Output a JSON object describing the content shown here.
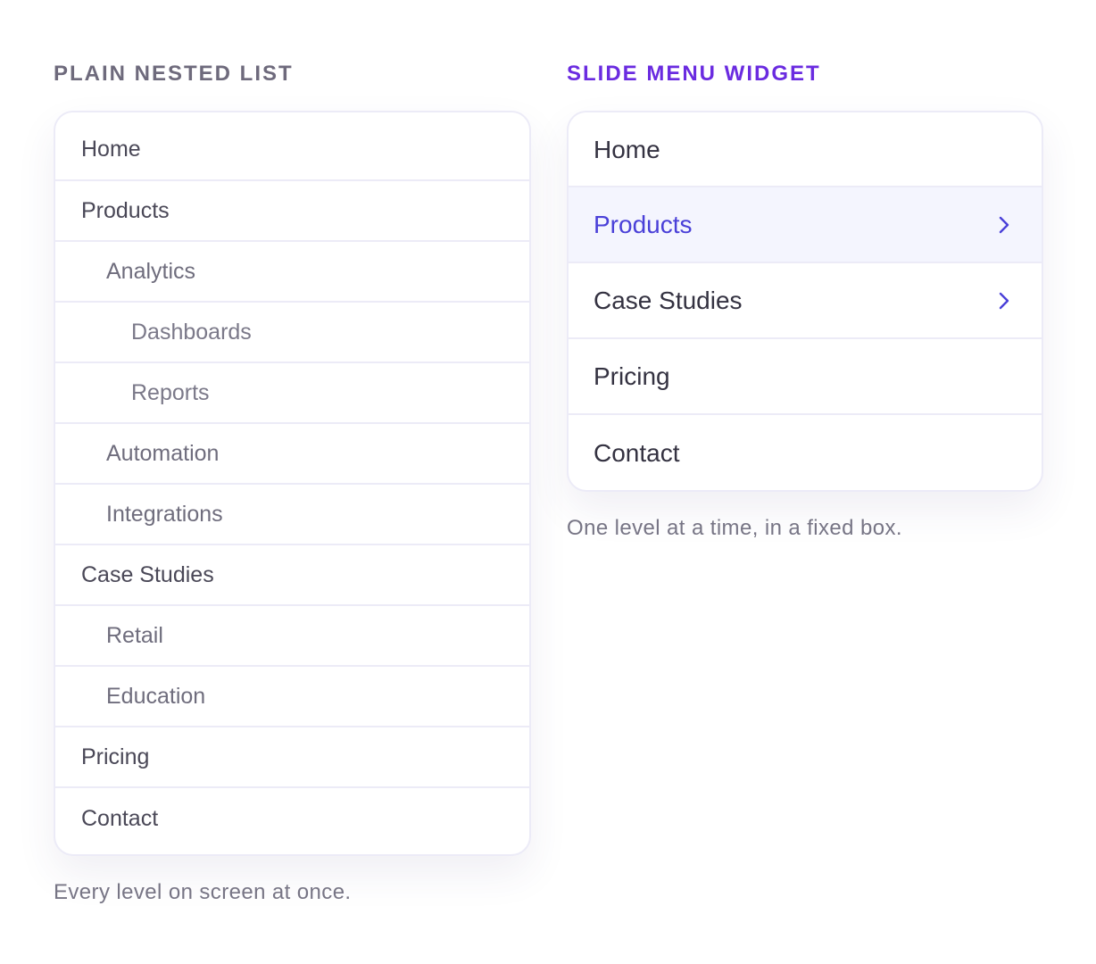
{
  "plain_panel": {
    "heading": "PLAIN NESTED LIST",
    "items": [
      {
        "label": "Home",
        "level": 0
      },
      {
        "label": "Products",
        "level": 0
      },
      {
        "label": "Analytics",
        "level": 1
      },
      {
        "label": "Dashboards",
        "level": 2
      },
      {
        "label": "Reports",
        "level": 2
      },
      {
        "label": "Automation",
        "level": 1
      },
      {
        "label": "Integrations",
        "level": 1
      },
      {
        "label": "Case Studies",
        "level": 0
      },
      {
        "label": "Retail",
        "level": 1
      },
      {
        "label": "Education",
        "level": 1
      },
      {
        "label": "Pricing",
        "level": 0
      },
      {
        "label": "Contact",
        "level": 0
      }
    ],
    "caption": "Every level on screen at once."
  },
  "slide_panel": {
    "heading": "SLIDE MENU WIDGET",
    "items": [
      {
        "label": "Home",
        "has_submenu": false,
        "active": false
      },
      {
        "label": "Products",
        "has_submenu": true,
        "active": true
      },
      {
        "label": "Case Studies",
        "has_submenu": true,
        "active": false
      },
      {
        "label": "Pricing",
        "has_submenu": false,
        "active": false
      },
      {
        "label": "Contact",
        "has_submenu": false,
        "active": false
      }
    ],
    "caption": "One level at a time, in a fixed box."
  },
  "icons": {
    "submenu_chevron": "chevron-right-icon"
  },
  "colors": {
    "accent": "#6a2be0",
    "active_text": "#4a40d8",
    "active_bg": "#f4f5fe",
    "border": "#ecebf7"
  }
}
